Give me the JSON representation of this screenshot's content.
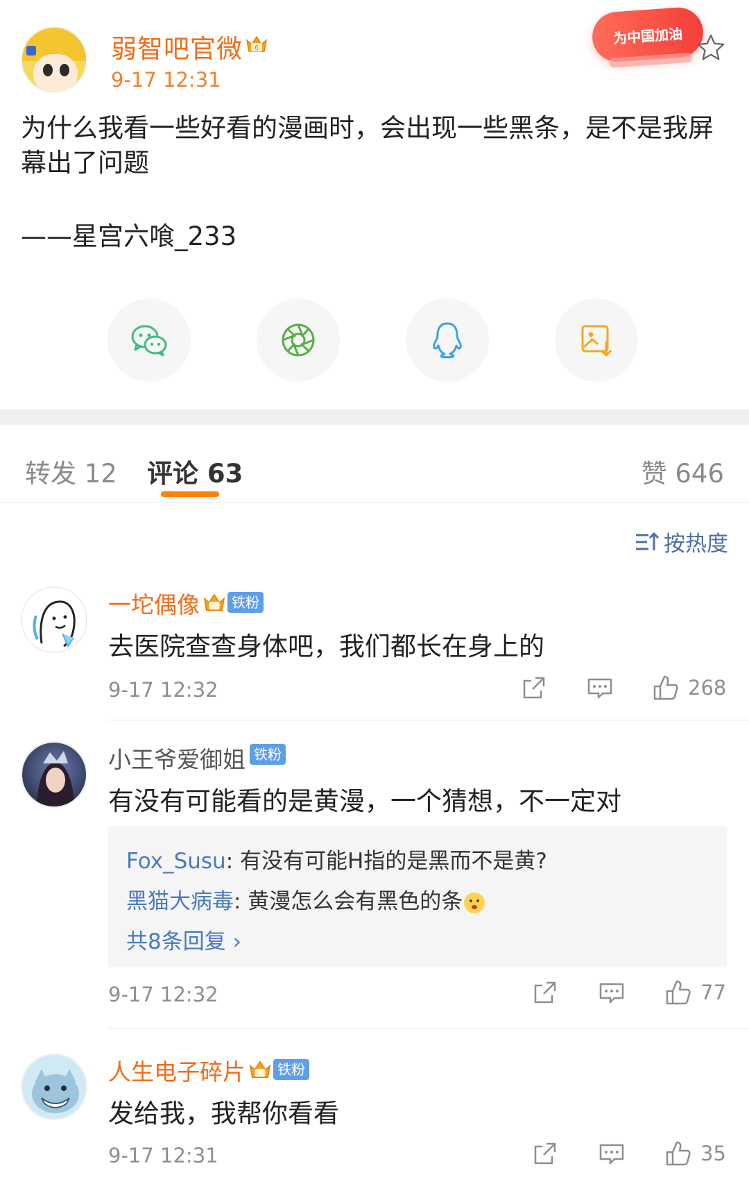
{
  "post": {
    "author": "弱智吧官微",
    "time": "9-17 12:31",
    "promo_badge": "为中国加油",
    "body": "为什么我看一些好看的漫画时，会出现一些黑条，是不是我屏幕出了问题",
    "signature": "——星宫六喰_233",
    "share_icons": [
      "wechat-icon",
      "moments-icon",
      "qq-icon",
      "save-image-icon"
    ]
  },
  "tabs": {
    "repost": "转发 12",
    "comments": "评论 63",
    "likes": "赞 646"
  },
  "sort": {
    "label": "按热度"
  },
  "comments": [
    {
      "name": "一坨偶像",
      "badge": "铁粉",
      "text": "去医院查查身体吧，我们都长在身上的",
      "time": "9-17 12:32",
      "likes": "268"
    },
    {
      "name": "小王爷爱御姐",
      "badge": "铁粉",
      "text": "有没有可能看的是黄漫，一个猜想，不一定对",
      "time": "9-17 12:32",
      "likes": "77",
      "replies": [
        {
          "user": "Fox_Susu",
          "text": ": 有没有可能H指的是黑而不是黄?"
        },
        {
          "user": "黑猫大病毒",
          "text": ": 黄漫怎么会有黑色的条"
        }
      ],
      "more_replies": "共8条回复 ›"
    },
    {
      "name": "人生电子碎片",
      "badge": "铁粉",
      "text": "发给我，我帮你看看",
      "time": "9-17 12:31",
      "likes": "35"
    }
  ],
  "colors": {
    "accent_orange": "#f26c18",
    "tab_underline": "#ff8200",
    "link_blue": "#4a7ac0",
    "badge_blue": "#5e9ee8"
  }
}
